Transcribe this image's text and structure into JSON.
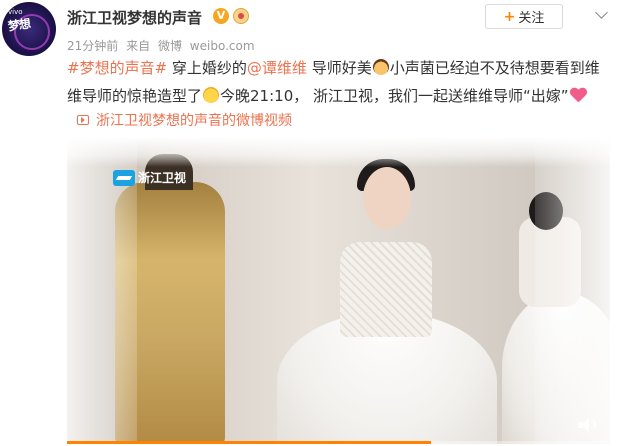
{
  "user": {
    "name": "浙江卫视梦想的声音",
    "verified_badge": "V",
    "avatar_text": "梦想",
    "avatar_brand": "vivo"
  },
  "meta": {
    "time": "21分钟前",
    "source_prefix": "来自",
    "source": "微博",
    "domain": "weibo.com"
  },
  "follow_button": {
    "label": "关注",
    "icon": "plus-icon"
  },
  "post": {
    "hashtag": "#梦想的声音#",
    "text_1": " 穿上婚纱的",
    "mention": "@谭维维",
    "text_2": " 导师好美",
    "text_3": "小声菌已经迫不及待想要看到维维导师的惊艳造型了",
    "text_4": "今晚21:10， 浙江卫视，我们一起送维维导师“出嫁”"
  },
  "video_link": {
    "label": "浙江卫视梦想的声音的微博视频",
    "icon": "video-icon"
  },
  "video": {
    "channel_logo_text": "浙江卫视",
    "progress": 0.67
  },
  "colors": {
    "link": "#eb7350",
    "follow_plus": "#ff8200",
    "text": "#333333",
    "meta": "#999999"
  }
}
